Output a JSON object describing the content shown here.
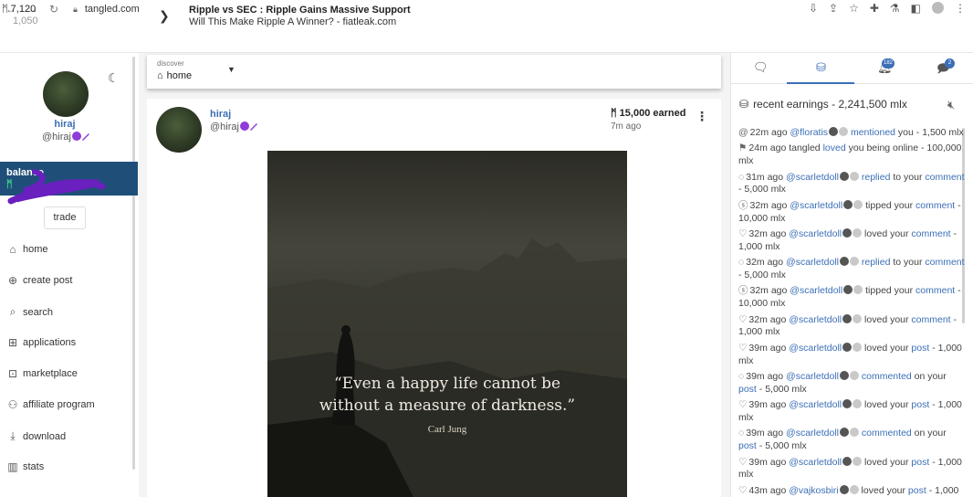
{
  "browser": {
    "url": "tangled.com",
    "nav_icons": [
      "←",
      "→",
      "↻"
    ],
    "right_icons": [
      "⇩",
      "⇪",
      "☆",
      "✚",
      "⚗",
      "◧"
    ]
  },
  "ticker": {
    "price": "7,120",
    "sub": "1,050",
    "news_title": "Ripple vs SEC : Ripple Gains Massive Support",
    "news_subtitle": "Will This Make Ripple A Winner? - fiatleak.com"
  },
  "profile": {
    "name": "hiraj",
    "handle": "@hiraj",
    "balance_label": "balance",
    "balance_symbol": "ᛗ",
    "trade_label": "trade"
  },
  "nav": [
    {
      "icon": "⌂",
      "icon_name": "home-icon",
      "label": "home"
    },
    {
      "icon": "⊕",
      "icon_name": "plus-circle-icon",
      "label": "create post"
    },
    {
      "icon": "⌕",
      "icon_name": "search-icon",
      "label": "search"
    },
    {
      "icon": "⊞",
      "icon_name": "grid-icon",
      "label": "applications"
    },
    {
      "icon": "⊡",
      "icon_name": "cart-icon",
      "label": "marketplace"
    },
    {
      "icon": "⚇",
      "icon_name": "people-icon",
      "label": "affiliate program"
    },
    {
      "icon": "⤓",
      "icon_name": "download-icon",
      "label": "download"
    },
    {
      "icon": "▥",
      "icon_name": "bar-chart-icon",
      "label": "stats"
    }
  ],
  "discover": {
    "label": "discover",
    "value": "home"
  },
  "post": {
    "name": "hiraj",
    "handle": "@hiraj",
    "earned": "15,000 earned",
    "time": "7m ago",
    "quote_line1": "“Even a happy life cannot be",
    "quote_line2": "without a measure of darkness.”",
    "quote_author": "Carl Jung"
  },
  "right_panel": {
    "tab_badge_1": "182",
    "tab_badge_2": "2",
    "title": "recent earnings - 2,241,500 mlx",
    "feed": [
      {
        "icon": "@",
        "time": "22m ago ",
        "user": "@floratis",
        "action": "mentioned",
        "rest": " you",
        "target": "",
        "amount": " - 1,500 mlx"
      },
      {
        "icon": "⚑",
        "time": "24m ago tangled ",
        "user": "",
        "action": "loved",
        "rest": " you being online",
        "target": "",
        "amount": " - 100,000 mlx"
      },
      {
        "icon": "◌",
        "time": "31m ago ",
        "user": "@scarletdoll",
        "action": "replied",
        "rest": " to your ",
        "target": "comment",
        "amount": " - 5,000 mlx"
      },
      {
        "icon": "ⓢ",
        "time": "32m ago ",
        "user": "@scarletdoll",
        "action": "",
        "rest": " tipped your ",
        "target": "comment",
        "amount": " - 10,000 mlx"
      },
      {
        "icon": "♡",
        "time": "32m ago ",
        "user": "@scarletdoll",
        "action": "",
        "rest": " loved your ",
        "target": "comment",
        "amount": " - 1,000 mlx"
      },
      {
        "icon": "◌",
        "time": "32m ago ",
        "user": "@scarletdoll",
        "action": "replied",
        "rest": " to your ",
        "target": "comment",
        "amount": " - 5,000 mlx"
      },
      {
        "icon": "ⓢ",
        "time": "32m ago ",
        "user": "@scarletdoll",
        "action": "",
        "rest": " tipped your ",
        "target": "comment",
        "amount": " - 10,000 mlx"
      },
      {
        "icon": "♡",
        "time": "32m ago ",
        "user": "@scarletdoll",
        "action": "",
        "rest": " loved your ",
        "target": "comment",
        "amount": " - 1,000 mlx"
      },
      {
        "icon": "♡",
        "time": "39m ago ",
        "user": "@scarletdoll",
        "action": "",
        "rest": " loved your ",
        "target": "post",
        "amount": " - 1,000 mlx"
      },
      {
        "icon": "◌",
        "time": "39m ago ",
        "user": "@scarletdoll",
        "action": "commented",
        "rest": " on your ",
        "target": "post",
        "amount": " - 5,000 mlx"
      },
      {
        "icon": "♡",
        "time": "39m ago ",
        "user": "@scarletdoll",
        "action": "",
        "rest": " loved your ",
        "target": "post",
        "amount": " - 1,000 mlx"
      },
      {
        "icon": "◌",
        "time": "39m ago ",
        "user": "@scarletdoll",
        "action": "commented",
        "rest": " on your ",
        "target": "post",
        "amount": " - 5,000 mlx"
      },
      {
        "icon": "♡",
        "time": "39m ago ",
        "user": "@scarletdoll",
        "action": "",
        "rest": " loved your ",
        "target": "post",
        "amount": " - 1,000 mlx"
      },
      {
        "icon": "♡",
        "time": "43m ago ",
        "user": "@vajkosbiri",
        "action": "",
        "rest": " loved your ",
        "target": "post",
        "amount": " - 1,000"
      }
    ]
  },
  "colors": {
    "link": "#3b6fb6",
    "balance_bg": "#1f4f79",
    "verified": "#8e3bd8"
  }
}
